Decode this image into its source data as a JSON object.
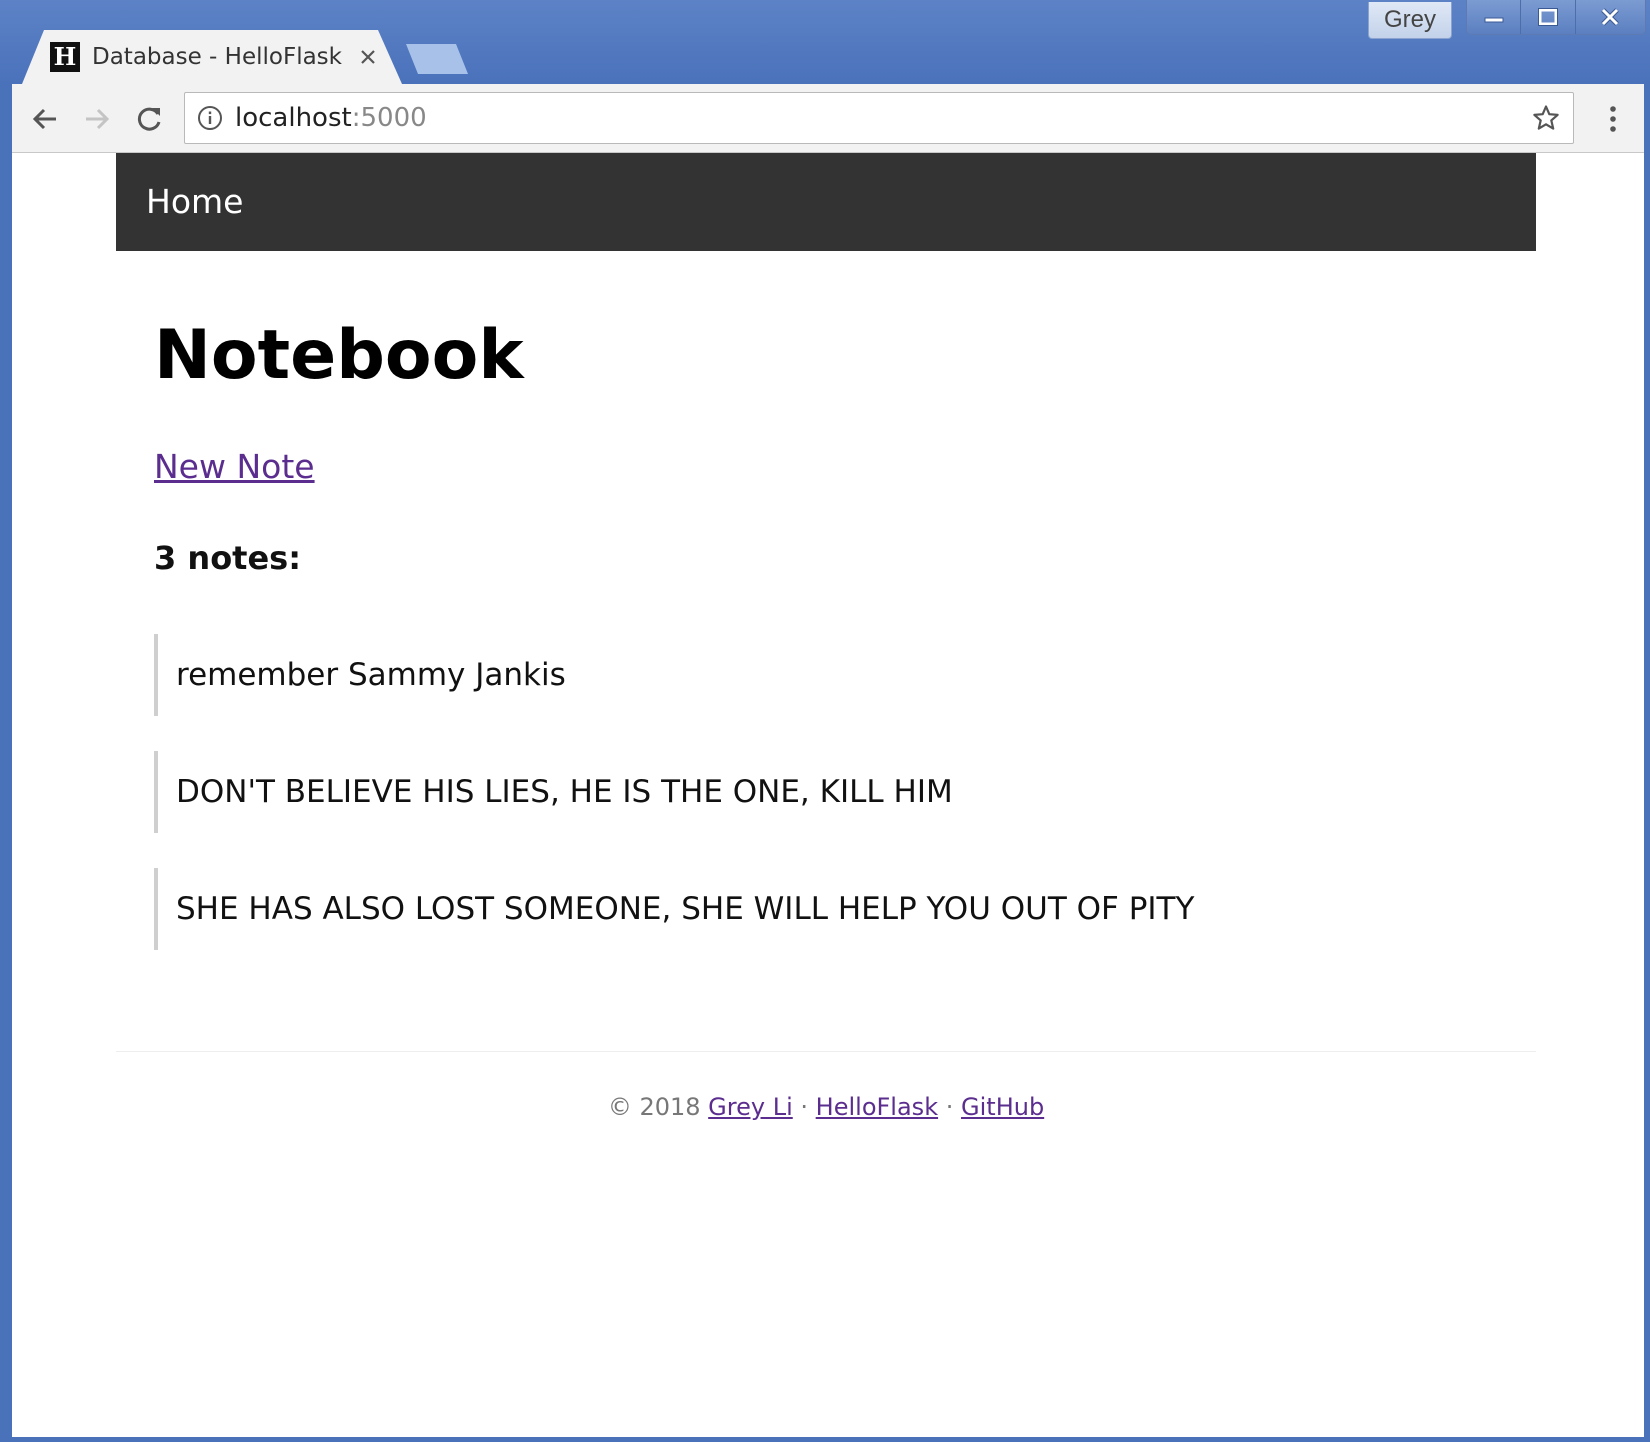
{
  "browser": {
    "profile_name": "Grey",
    "tab": {
      "favicon_letter": "H",
      "title": "Database - HelloFlask"
    },
    "address": {
      "host": "localhost",
      "port": ":5000"
    },
    "icons": {
      "back": "arrow-left-icon",
      "forward": "arrow-right-icon",
      "reload": "reload-icon",
      "site_info": "info-icon",
      "bookmark": "star-icon",
      "menu": "kebab-menu-icon",
      "minimize": "minimize-icon",
      "maximize": "maximize-icon",
      "close": "close-icon"
    }
  },
  "page": {
    "navbar": {
      "home_label": "Home"
    },
    "title": "Notebook",
    "new_note_label": "New Note",
    "notes_count_label": "3 notes:",
    "notes": [
      "remember Sammy Jankis",
      "DON'T BELIEVE HIS LIES, HE IS THE ONE, KILL HIM",
      "SHE HAS ALSO LOST SOMEONE, SHE WILL HELP YOU OUT OF PITY"
    ],
    "footer": {
      "copyright": "© 2018",
      "author_link": "Grey Li",
      "sep1": "·",
      "project_link": "HelloFlask",
      "sep2": "·",
      "github_link": "GitHub"
    }
  },
  "colors": {
    "frame_blue": "#4a72bb",
    "navbar_bg": "#333333",
    "link_purple": "#5b2d8e",
    "blockquote_border": "#cfcfcf"
  }
}
